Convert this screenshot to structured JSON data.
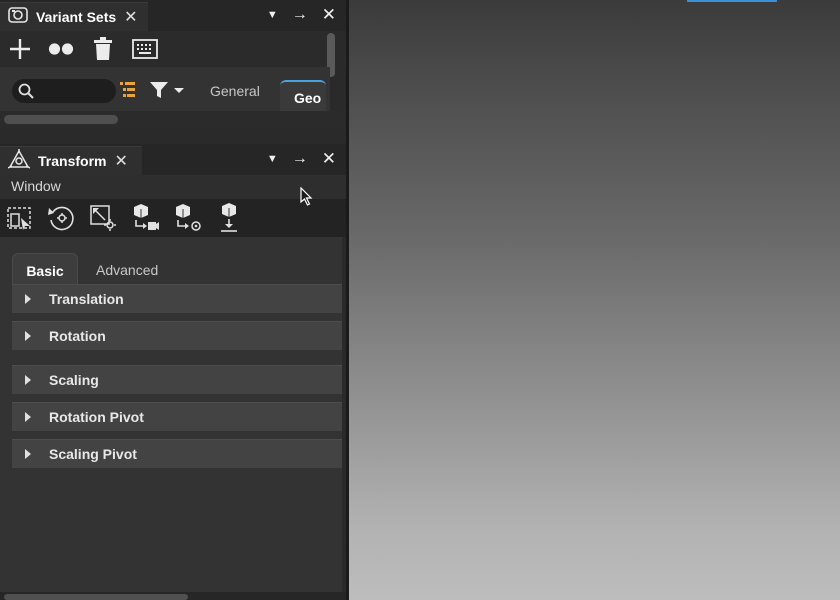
{
  "variant_sets_panel": {
    "title": "Variant Sets",
    "close_glyph": "✕",
    "controls": {
      "dropdown": "▼",
      "float": "→",
      "close": "✕"
    },
    "toolbar_icons": [
      "plus-icon",
      "variant-dots-icon",
      "trash-icon",
      "keyboard-icon"
    ],
    "search": {
      "value": "",
      "placeholder": ""
    },
    "filter_icons": [
      "hierarchy-icon",
      "filter-icon"
    ],
    "tabs": [
      {
        "label": "General",
        "active": false
      },
      {
        "label": "Geo",
        "active": true
      }
    ]
  },
  "transform_panel": {
    "title": "Transform",
    "close_glyph": "✕",
    "controls": {
      "dropdown": "▼",
      "float": "→",
      "close": "✕"
    },
    "menu": {
      "window": "Window"
    },
    "toolbar_icons": [
      "select-pivot-icon",
      "reset-rotation-icon",
      "scale-pivot-icon",
      "move-to-camera-icon",
      "move-to-pivot-icon",
      "drop-to-ground-icon"
    ],
    "tabs": [
      {
        "label": "Basic",
        "active": true
      },
      {
        "label": "Advanced",
        "active": false
      }
    ],
    "sections": [
      {
        "label": "Translation"
      },
      {
        "label": "Rotation"
      },
      {
        "label": "Scaling"
      },
      {
        "label": "Rotation Pivot"
      },
      {
        "label": "Scaling Pivot"
      }
    ]
  },
  "colors": {
    "accent": "#4aa3df",
    "filter_accent": "#e8a33a",
    "panel_bg": "#333333",
    "header_bg": "#262626"
  }
}
